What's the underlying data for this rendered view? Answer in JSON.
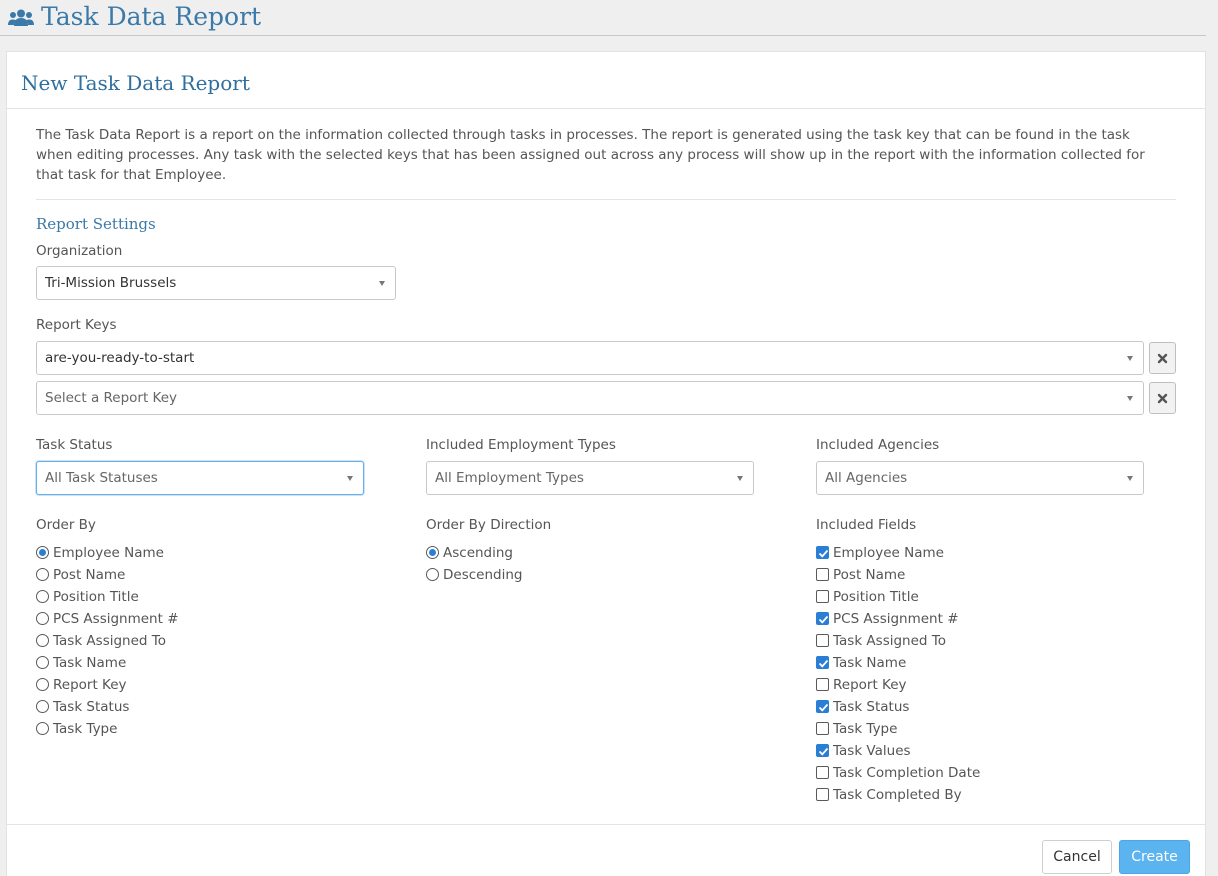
{
  "header": {
    "title": "Task Data Report",
    "icon": "users-icon"
  },
  "panel": {
    "title": "New Task Data Report",
    "description": "The Task Data Report is a report on the information collected through tasks in processes. The report is generated using the task key that can be found in the task when editing processes. Any task with the selected keys that has been assigned out across any process will show up in the report with the information collected for that task for that Employee."
  },
  "settings": {
    "section_title": "Report Settings",
    "organization": {
      "label": "Organization",
      "value": "Tri-Mission Brussels"
    },
    "report_keys": {
      "label": "Report Keys",
      "key1": "are-you-ready-to-start",
      "key2_placeholder": "Select a Report Key"
    },
    "task_status": {
      "label": "Task Status",
      "value": "All Task Statuses"
    },
    "employment_types": {
      "label": "Included Employment Types",
      "value": "All Employment Types"
    },
    "agencies": {
      "label": "Included Agencies",
      "value": "All Agencies"
    }
  },
  "order_by": {
    "label": "Order By",
    "selected": "Employee Name",
    "options": [
      "Employee Name",
      "Post Name",
      "Position Title",
      "PCS Assignment #",
      "Task Assigned To",
      "Task Name",
      "Report Key",
      "Task Status",
      "Task Type"
    ]
  },
  "order_direction": {
    "label": "Order By Direction",
    "selected": "Ascending",
    "options": [
      "Ascending",
      "Descending"
    ]
  },
  "included_fields": {
    "label": "Included Fields",
    "fields": [
      {
        "label": "Employee Name",
        "checked": true
      },
      {
        "label": "Post Name",
        "checked": false
      },
      {
        "label": "Position Title",
        "checked": false
      },
      {
        "label": "PCS Assignment #",
        "checked": true
      },
      {
        "label": "Task Assigned To",
        "checked": false
      },
      {
        "label": "Task Name",
        "checked": true
      },
      {
        "label": "Report Key",
        "checked": false
      },
      {
        "label": "Task Status",
        "checked": true
      },
      {
        "label": "Task Type",
        "checked": false
      },
      {
        "label": "Task Values",
        "checked": true
      },
      {
        "label": "Task Completion Date",
        "checked": false
      },
      {
        "label": "Task Completed By",
        "checked": false
      }
    ]
  },
  "footer": {
    "cancel_label": "Cancel",
    "create_label": "Create"
  },
  "colors": {
    "accent": "#3b79a8",
    "primary_button": "#5bb3ef",
    "check": "#2a7fd4"
  }
}
